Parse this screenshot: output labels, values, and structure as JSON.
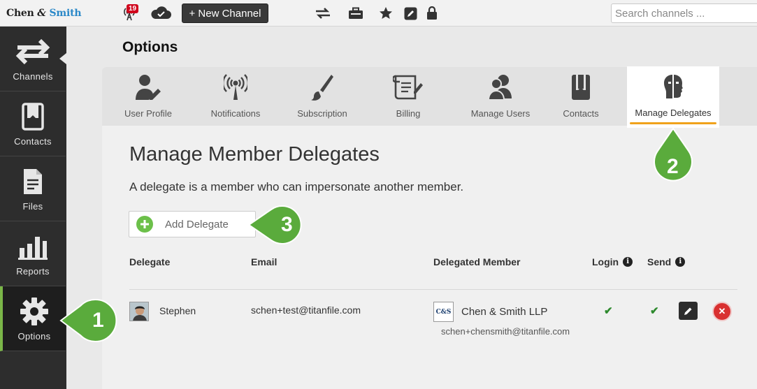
{
  "app": {
    "logo_part1": "Chen",
    "logo_amp": "&",
    "logo_part2": "Smith",
    "notification_count": "19",
    "new_channel_label": "+ New Channel",
    "search_placeholder": "Search channels ..."
  },
  "sidebar": {
    "items": [
      {
        "label": "Channels",
        "icon": "transfer-arrows-icon"
      },
      {
        "label": "Contacts",
        "icon": "address-book-icon"
      },
      {
        "label": "Files",
        "icon": "file-icon"
      },
      {
        "label": "Reports",
        "icon": "bar-chart-icon"
      },
      {
        "label": "Options",
        "icon": "gear-icon",
        "active": true
      }
    ]
  },
  "page": {
    "heading": "Options"
  },
  "tabs": [
    {
      "label": "User Profile",
      "icon": "user-edit-icon"
    },
    {
      "label": "Notifications",
      "icon": "broadcast-icon"
    },
    {
      "label": "Subscription",
      "icon": "paintbrush-icon"
    },
    {
      "label": "Billing",
      "icon": "scroll-icon"
    },
    {
      "label": "Manage Users",
      "icon": "users-icon"
    },
    {
      "label": "Contacts",
      "icon": "book-icon"
    },
    {
      "label": "Manage Delegates",
      "icon": "masks-icon",
      "active": true
    }
  ],
  "delegates": {
    "title": "Manage Member Delegates",
    "description": "A delegate is a member who can impersonate another member.",
    "add_label": "Add Delegate",
    "columns": {
      "delegate": "Delegate",
      "email": "Email",
      "member": "Delegated Member",
      "login": "Login",
      "send": "Send"
    },
    "rows": [
      {
        "delegate": "Stephen",
        "email": "schen+test@titanfile.com",
        "member_logo": "C&S",
        "member": "Chen & Smith LLP",
        "member_email": "schen+chensmith@titanfile.com",
        "login": "✔",
        "send": "✔",
        "delete": "✕"
      }
    ]
  },
  "callouts": [
    "1",
    "2",
    "3"
  ],
  "colors": {
    "accent_green": "#6cc04a",
    "callout_green": "#5aab3c",
    "tab_underline": "#f0a21b",
    "sidebar_bg": "#2d2d2d",
    "danger": "#d93030"
  }
}
